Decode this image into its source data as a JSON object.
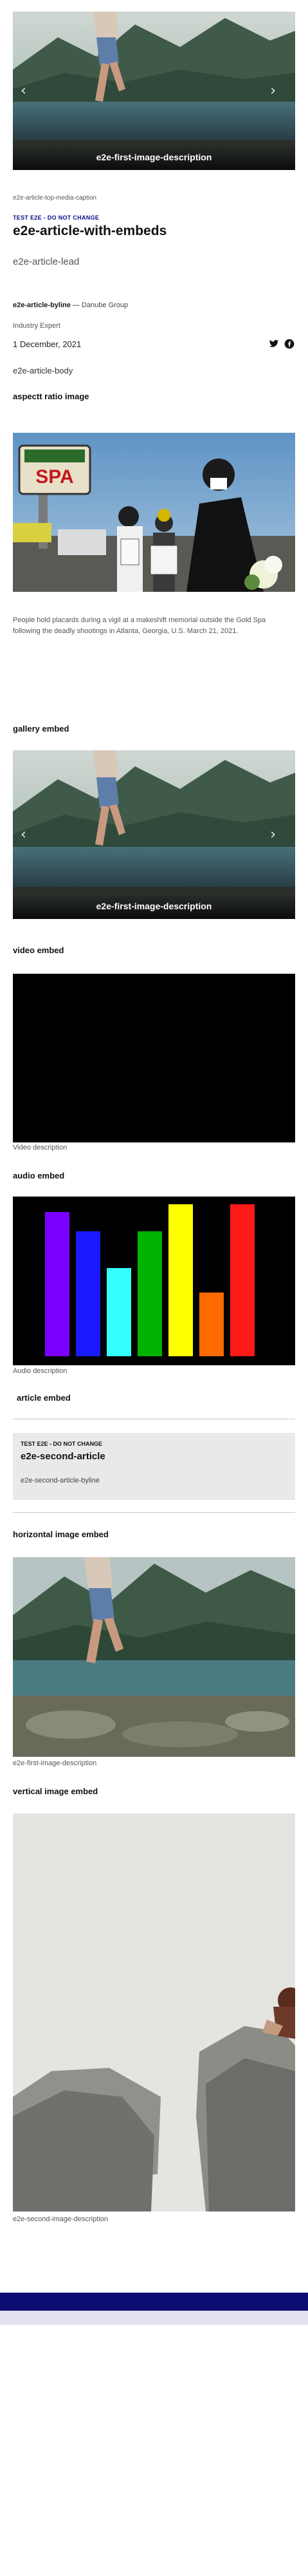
{
  "gallery_top": {
    "caption": "e2e-first-image-description",
    "prev_icon": "chevron-left-icon",
    "next_icon": "chevron-right-icon"
  },
  "top_media_caption": "e2e-article-top-media-caption",
  "kicker": "TEST E2E - DO NOT CHANGE",
  "title": "e2e-article-with-embeds",
  "lead": "e2e-article-lead",
  "byline": {
    "name": "e2e-article-byline",
    "separator": " — ",
    "org": "Danube Group",
    "role": "Industry Expert",
    "date": "1 December, 2021"
  },
  "share": {
    "twitter_icon": "twitter-icon",
    "facebook_icon": "facebook-icon"
  },
  "body": "e2e-article-body",
  "aspect_ratio": {
    "heading": "aspectt ratio image",
    "sign_text": "SPA",
    "caption": "People hold placards during a vigil at a makeshift memorial outside the Gold Spa following the deadly shootings in Atlanta, Georgia, U.S. March 21, 2021."
  },
  "gallery_embed": {
    "heading": "gallery embed",
    "caption": "e2e-first-image-description"
  },
  "video_embed": {
    "heading": "video embed",
    "description": "Video description"
  },
  "audio_embed": {
    "heading": "audio embed",
    "description": "Audio description",
    "bars": [
      {
        "color": "#7b00ff",
        "level": 0.95
      },
      {
        "color": "#1a1aff",
        "level": 0.82
      },
      {
        "color": "#33ffff",
        "level": 0.58
      },
      {
        "color": "#00b300",
        "level": 0.82
      },
      {
        "color": "#ffff00",
        "level": 1.0
      },
      {
        "color": "#ff6a00",
        "level": 0.42
      },
      {
        "color": "#ff1a1a",
        "level": 1.0
      }
    ]
  },
  "article_embed": {
    "heading": "article embed",
    "kicker": "TEST E2E - DO NOT CHANGE",
    "title": "e2e-second-article",
    "byline": "e2e-second-article-byline"
  },
  "horizontal_embed": {
    "heading": "horizontal image embed",
    "caption": "e2e-first-image-description"
  },
  "vertical_embed": {
    "heading": "vertical image embed",
    "caption": "e2e-second-image-description"
  },
  "colors": {
    "brand": "#0c0c72",
    "kicker": "#0c0c8a",
    "footer_light": "#e3e3ef"
  }
}
